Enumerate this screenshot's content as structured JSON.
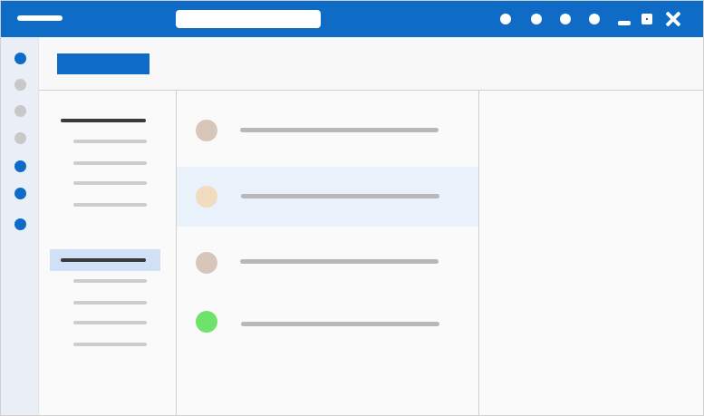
{
  "colors": {
    "accent": "#0f6cc6",
    "rail_inactive": "#c8c8c8",
    "nav_selected_bg": "#cfe0f7",
    "row_selected_bg": "#e9f1fb"
  },
  "titlebar": {
    "menu_icon": "hamburger-icon",
    "search_placeholder": "",
    "controls": [
      "minimize-icon",
      "maximize-icon",
      "close-icon"
    ]
  },
  "rail": {
    "items": [
      {
        "icon": "mail-icon",
        "active": true
      },
      {
        "icon": "calendar-icon",
        "active": false
      },
      {
        "icon": "people-icon",
        "active": false
      },
      {
        "icon": "tasks-icon",
        "active": false
      },
      {
        "icon": "files-icon",
        "active": true
      },
      {
        "icon": "apps-icon",
        "active": true
      },
      {
        "icon": "more-icon",
        "active": true
      }
    ]
  },
  "list": {
    "rows": [
      {
        "avatar_color": "#d8c6bb",
        "selected": false
      },
      {
        "avatar_color": "#f2dcbf",
        "selected": true
      },
      {
        "avatar_color": "#d8c6bb",
        "selected": false
      },
      {
        "avatar_color": "#6ee26b",
        "selected": false
      }
    ]
  }
}
